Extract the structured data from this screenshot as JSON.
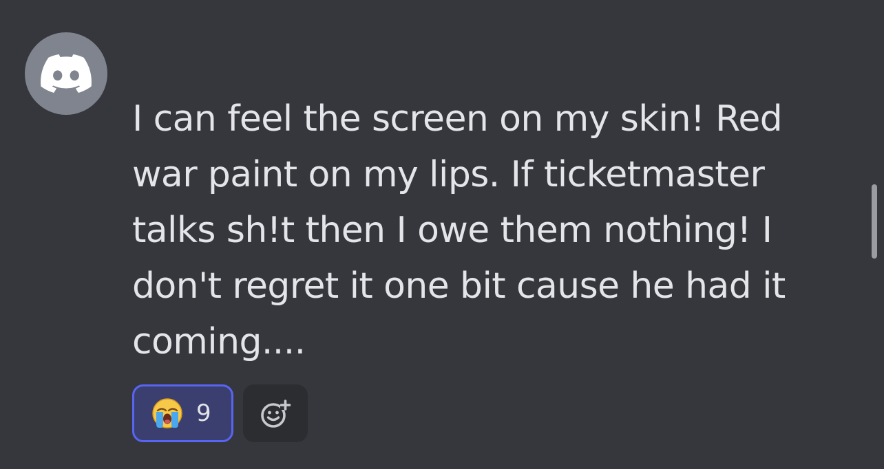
{
  "message": {
    "text": "I can feel the screen on my skin! Red war paint on my lips. If ticketmaster talks sh!t then I owe them nothing! I don't regret it one bit cause he had it coming....",
    "avatar_icon": "discord-logo-icon"
  },
  "reactions": [
    {
      "emoji": "loudly-crying-face",
      "count": "9",
      "active": true
    }
  ],
  "add_reaction_icon": "add-reaction-icon",
  "colors": {
    "background": "#36373d",
    "avatar_background": "#80848e",
    "message_text": "#e4e5e8",
    "reaction_active_fill": "#3b3f70",
    "reaction_active_border": "#5865f2",
    "add_reaction_fill": "#2b2d31"
  }
}
